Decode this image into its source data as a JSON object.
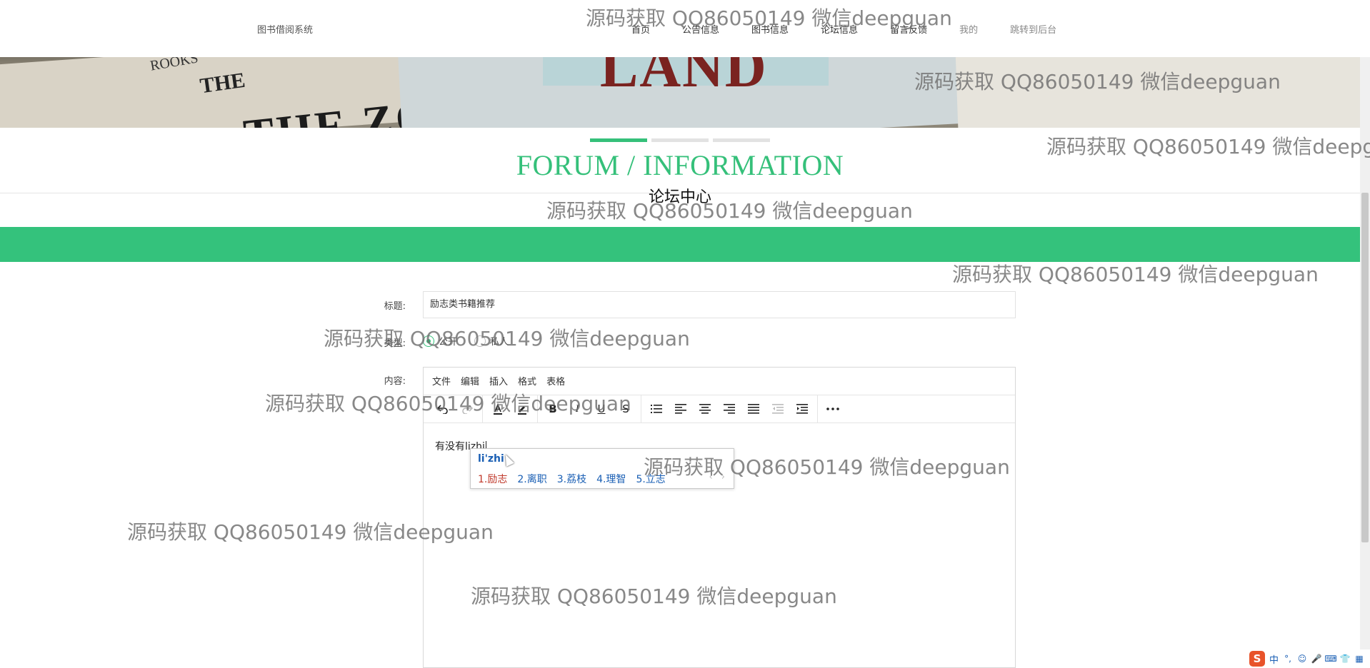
{
  "header": {
    "brand": "图书借阅系统",
    "nav": [
      {
        "label": "首页"
      },
      {
        "label": "公告信息"
      },
      {
        "label": "图书信息"
      },
      {
        "label": "论坛信息"
      },
      {
        "label": "留言反馈"
      },
      {
        "label": "我的"
      },
      {
        "label": "跳转到后台"
      }
    ]
  },
  "banner": {
    "book_text_1": "THE ZOMBIE",
    "book_text_the": "THE",
    "book_text_rooks": "ROOKS",
    "book_text_2": "LAND"
  },
  "section": {
    "en_title": "FORUM / INFORMATION",
    "cn_title": "论坛中心"
  },
  "form": {
    "title_label": "标题:",
    "title_value": "励志类书籍推荐",
    "type_label": "类型:",
    "type_options": [
      {
        "label": "公开",
        "checked": true
      },
      {
        "label": "私人",
        "checked": false
      }
    ],
    "content_label": "内容:"
  },
  "editor": {
    "menu": [
      "文件",
      "编辑",
      "插入",
      "格式",
      "表格"
    ],
    "toolbar_icons": [
      "undo-icon",
      "redo-icon",
      "text-color-icon",
      "highlight-color-icon",
      "bold-icon",
      "italic-icon",
      "underline-icon",
      "strikethrough-icon",
      "bullet-list-icon",
      "align-left-icon",
      "align-center-icon",
      "align-right-icon",
      "align-justify-icon",
      "outdent-icon",
      "indent-icon",
      "more-icon"
    ],
    "body_text": "有没有lizhi"
  },
  "ime": {
    "composition": "li'zhi",
    "candidates": [
      "1.励志",
      "2.离职",
      "3.荔枝",
      "4.理智",
      "5.立志"
    ],
    "arrows": "‹ ›"
  },
  "watermark": "源码获取 QQ86050149 微信deepguan",
  "tray": {
    "ime_mode": "中"
  },
  "colors": {
    "accent": "#35c07a",
    "candidate_blue": "#1a5fb4",
    "candidate_first": "#c0392b"
  }
}
